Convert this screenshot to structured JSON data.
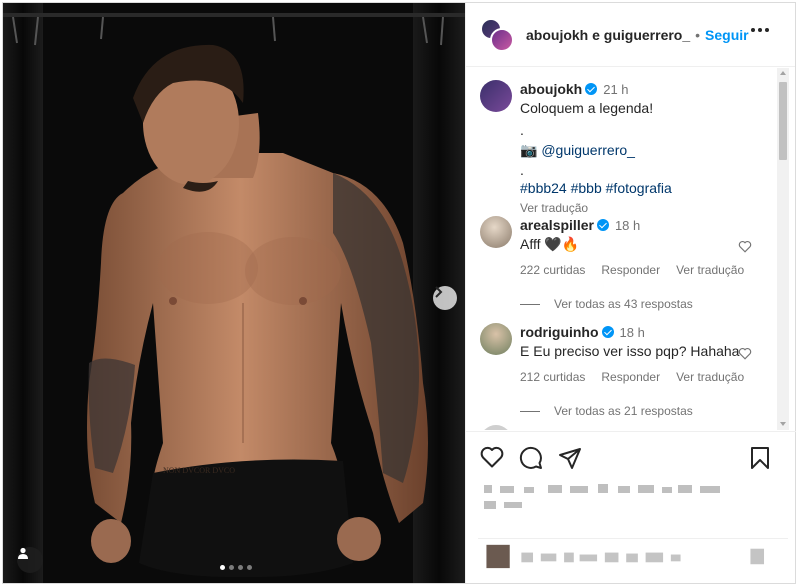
{
  "header": {
    "users": "aboujokh e guiguerrero_",
    "separator": "•",
    "follow_label": "Seguir"
  },
  "caption": {
    "username": "aboujokh",
    "time": "21 h",
    "line1": "Coloquem a legenda!",
    "dot1": ".",
    "camera_emoji": "📷",
    "mention": "@guiguerrero_",
    "dot2": ".",
    "hashtags": "#bbb24 #bbb #fotografia",
    "translation": "Ver tradução"
  },
  "comments": [
    {
      "username": "arealspiller",
      "time": "18 h",
      "text": "Afff 🖤🔥",
      "likes": "222 curtidas",
      "reply": "Responder",
      "translation": "Ver tradução",
      "replies": "Ver todas as 43 respostas"
    },
    {
      "username": "rodriguinho",
      "time": "18 h",
      "text": "E Eu preciso ver isso pqp? Hahaha",
      "likes": "212 curtidas",
      "reply": "Responder",
      "translation": "Ver tradução",
      "replies": "Ver todas as 21 respostas"
    }
  ],
  "carousel": {
    "slides": 4,
    "active": 1
  },
  "icons": [
    "like-icon",
    "comment-icon",
    "share-icon",
    "save-icon",
    "more-options-icon",
    "next-slide-icon",
    "user-tags-icon",
    "verified-icon"
  ],
  "colors": {
    "follow": "#0095f6",
    "verified": "#0095f6",
    "link": "#00376b",
    "muted": "#737373"
  }
}
